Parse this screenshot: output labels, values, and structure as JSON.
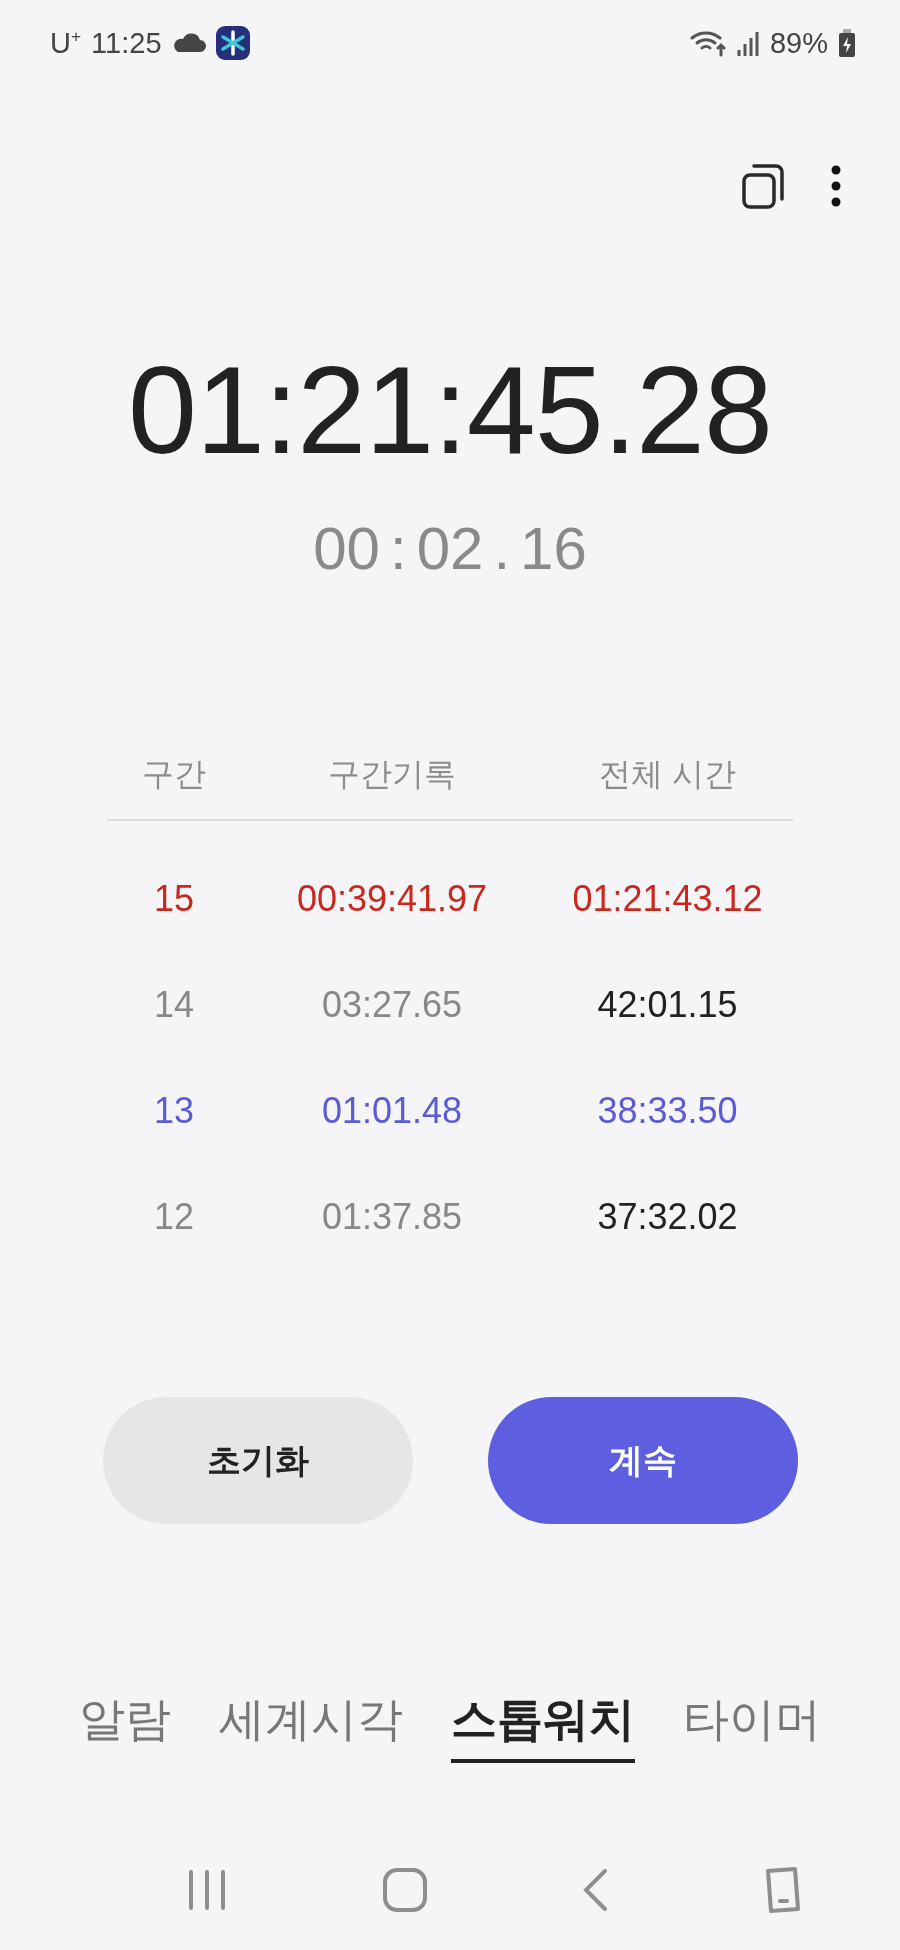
{
  "status_bar": {
    "carrier": "U$^{+}$",
    "time": "11:25",
    "battery": "89%"
  },
  "stopwatch": {
    "total": "01:21:45.28",
    "lap": [
      "00",
      ":",
      "02",
      ".",
      "16"
    ]
  },
  "laps": {
    "columns": [
      "구간",
      "구간기록",
      "전체 시간"
    ],
    "rows": [
      {
        "number": "15",
        "lap_time": "00:39:41.97",
        "total_time": "01:21:43.12",
        "color": "#c8281e"
      },
      {
        "number": "14",
        "lap_time": "03:27.65",
        "total_time": "42:01.15"
      },
      {
        "number": "13",
        "lap_time": "01:01.48",
        "total_time": "38:33.50",
        "color": "#5b5bd6"
      },
      {
        "number": "12",
        "lap_time": "01:37.85",
        "total_time": "37:32.02"
      }
    ]
  },
  "buttons": [
    {
      "label": "초기화",
      "kind": "secondary"
    },
    {
      "label": "계속",
      "kind": "primary"
    }
  ],
  "tabs": [
    {
      "label": "알람",
      "selected": false
    },
    {
      "label": "세계시각",
      "selected": false
    },
    {
      "label": "스톱워치",
      "selected": true
    },
    {
      "label": "타이머",
      "selected": false
    }
  ]
}
